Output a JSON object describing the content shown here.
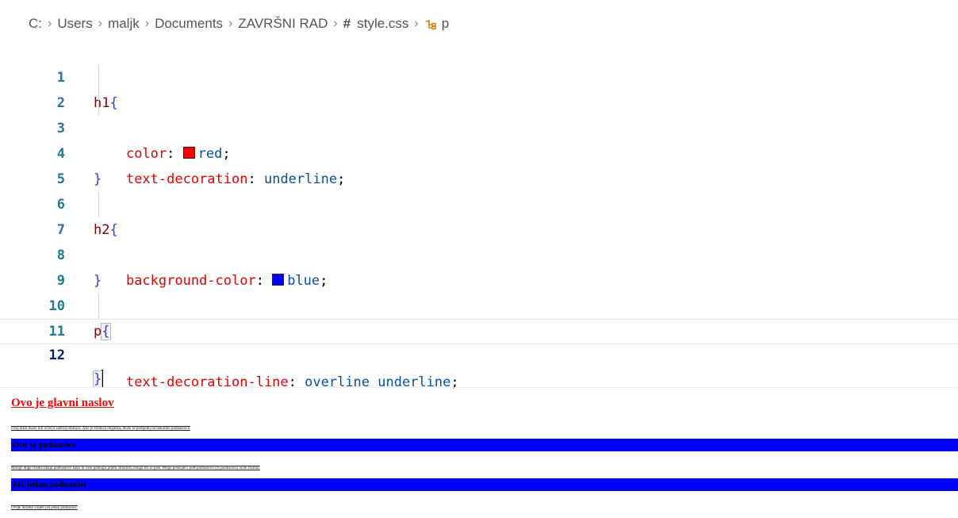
{
  "breadcrumb": {
    "path": [
      "C:",
      "Users",
      "maljk",
      "Documents",
      "ZAVRŠNI RAD"
    ],
    "file_icon": "hash-icon",
    "file_icon_glyph": "#",
    "file": "style.css",
    "symbol_icon": "css-selector-icon",
    "symbol": "p"
  },
  "editor": {
    "line_numbers": [
      "1",
      "2",
      "3",
      "4",
      "5",
      "6",
      "7",
      "8",
      "9",
      "10",
      "11",
      "12"
    ],
    "current_line": "12",
    "lines": {
      "l1": {
        "selector": "h1",
        "brace": "{"
      },
      "l2": {
        "prop": "color",
        "colon": ": ",
        "value": "red",
        "semi": ";",
        "swatch_color": "#ff0000"
      },
      "l3": {
        "prop": "text-decoration",
        "colon": ": ",
        "value": "underline",
        "semi": ";"
      },
      "l4": {
        "brace": "}"
      },
      "l6": {
        "selector": "h2",
        "brace": "{"
      },
      "l7": {
        "prop": "background-color",
        "colon": ": ",
        "value": "blue",
        "semi": ";",
        "swatch_color": "#0000ff"
      },
      "l8": {
        "brace": "}"
      },
      "l10": {
        "selector": "p",
        "brace": "{"
      },
      "l11": {
        "prop": "text-decoration-line",
        "colon": ": ",
        "value": "overline underline",
        "semi": ";"
      },
      "l12": {
        "brace": "}"
      }
    }
  },
  "preview": {
    "h1": "Ovo je glavni naslov",
    "p1": "Ovaj tekst može biti uvod u sadržaj stranice. Ako je stranica dugačka, može se podijeliti na nekoliko podnaslova.",
    "h2a": "Ovo je podnaslov",
    "p2": "Mnogo duge članke imaju podnaslove kako bi vam pomogli pratiti strukturu onoga što se piše. Mogu postojati i pod-podnaslovi (ili podnaslovi nižih razina).",
    "h2b": "Još jedan podnaslov",
    "p3": "Ovdje možete vidjeti još jedan podnaslov."
  },
  "colors": {
    "line_number": "#237893",
    "selector": "#800000",
    "property": "#e50000",
    "value": "#0451a5",
    "h1_text": "#ff0000",
    "h2_background": "#0000ff"
  }
}
